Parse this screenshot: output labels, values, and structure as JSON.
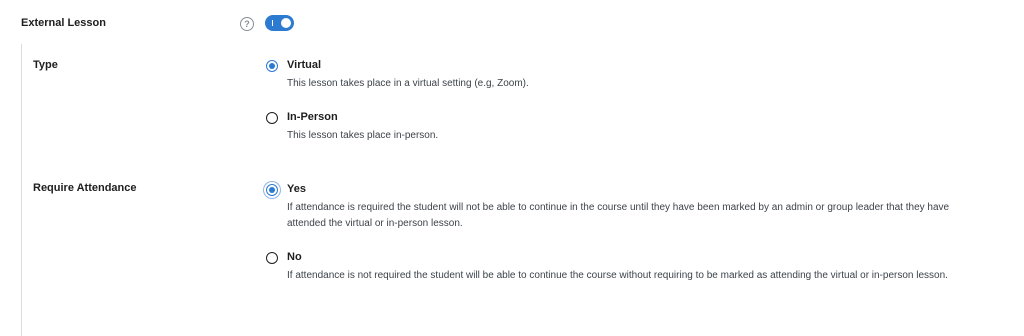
{
  "external_lesson": {
    "label": "External Lesson",
    "help_icon": "question-circle-icon",
    "help_glyph": "?",
    "toggle_on": true
  },
  "type_section": {
    "label": "Type",
    "options": [
      {
        "title": "Virtual",
        "description": "This lesson takes place in a virtual setting (e.g, Zoom).",
        "selected": true
      },
      {
        "title": "In-Person",
        "description": "This lesson takes place in-person.",
        "selected": false
      }
    ]
  },
  "attendance_section": {
    "label": "Require Attendance",
    "options": [
      {
        "title": "Yes",
        "description": "If attendance is required the student will not be able to continue in the course until they have been marked by an admin or group leader that they have attended the virtual or in-person lesson.",
        "selected": true
      },
      {
        "title": "No",
        "description": "If attendance is not required the student will be able to continue the course without requiring to be marked as attending the virtual or in-person lesson.",
        "selected": false
      }
    ]
  },
  "colors": {
    "accent": "#2c7bd0",
    "text": "#1e1e1e",
    "muted": "#3c434a"
  }
}
